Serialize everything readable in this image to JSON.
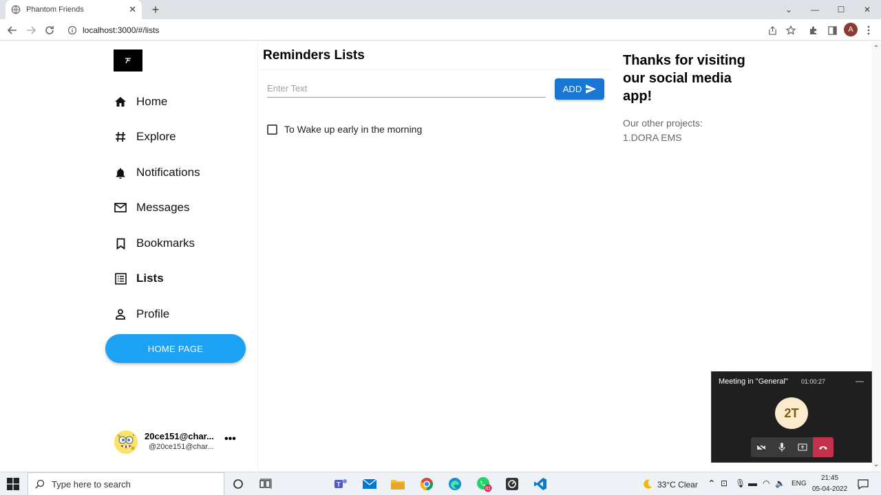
{
  "browser": {
    "tab_title": "Phantom Friends",
    "url": "localhost:3000/#/lists",
    "profile_initial": "A"
  },
  "sidebar": {
    "items": [
      {
        "label": "Home",
        "icon": "home-icon"
      },
      {
        "label": "Explore",
        "icon": "hashtag-icon"
      },
      {
        "label": "Notifications",
        "icon": "bell-icon"
      },
      {
        "label": "Messages",
        "icon": "mail-icon"
      },
      {
        "label": "Bookmarks",
        "icon": "bookmark-icon"
      },
      {
        "label": "Lists",
        "icon": "list-icon"
      },
      {
        "label": "Profile",
        "icon": "person-icon"
      }
    ],
    "active": "Lists",
    "home_button": "HOME PAGE",
    "user": {
      "name": "20ce151@char...",
      "handle": "@20ce151@char..."
    }
  },
  "main": {
    "title": "Reminders Lists",
    "input_placeholder": "Enter Text",
    "add_label": "ADD",
    "reminders": [
      {
        "text": "To Wake up early in the morning",
        "checked": false
      }
    ]
  },
  "right_panel": {
    "thanks": "Thanks for visiting our social media app!",
    "other_label": "Our other projects:",
    "projects": [
      "1.DORA EMS"
    ]
  },
  "teams_popup": {
    "title": "Meeting in \"General\"",
    "timer": "01:00:27",
    "avatar_initials": "2T"
  },
  "taskbar": {
    "search_placeholder": "Type here to search",
    "weather": "33°C  Clear",
    "language": "ENG",
    "time": "21:45",
    "date": "05-04-2022",
    "whatsapp_badge": "81"
  },
  "colors": {
    "home_button": "#1da1f2",
    "add_button": "#1976d2",
    "teams_end": "#c4314b"
  }
}
